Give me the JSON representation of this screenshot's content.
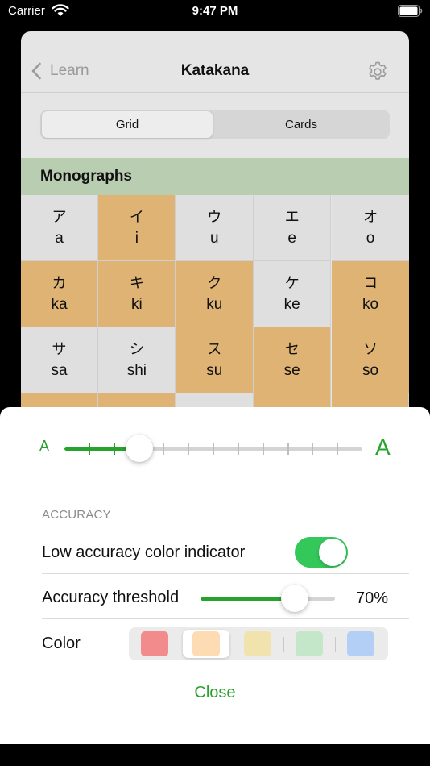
{
  "status_bar": {
    "carrier": "Carrier",
    "time": "9:47 PM"
  },
  "nav": {
    "back_label": "Learn",
    "title": "Katakana"
  },
  "segments": {
    "grid_label": "Grid",
    "cards_label": "Cards",
    "selected": "Grid"
  },
  "section": {
    "title": "Monographs"
  },
  "grid_rows": [
    [
      {
        "kana": "ア",
        "romaji": "a",
        "highlight": false
      },
      {
        "kana": "イ",
        "romaji": "i",
        "highlight": true
      },
      {
        "kana": "ウ",
        "romaji": "u",
        "highlight": false
      },
      {
        "kana": "エ",
        "romaji": "e",
        "highlight": false
      },
      {
        "kana": "オ",
        "romaji": "o",
        "highlight": false
      }
    ],
    [
      {
        "kana": "カ",
        "romaji": "ka",
        "highlight": true
      },
      {
        "kana": "キ",
        "romaji": "ki",
        "highlight": true
      },
      {
        "kana": "ク",
        "romaji": "ku",
        "highlight": true
      },
      {
        "kana": "ケ",
        "romaji": "ke",
        "highlight": false
      },
      {
        "kana": "コ",
        "romaji": "ko",
        "highlight": true
      }
    ],
    [
      {
        "kana": "サ",
        "romaji": "sa",
        "highlight": false
      },
      {
        "kana": "シ",
        "romaji": "shi",
        "highlight": false
      },
      {
        "kana": "ス",
        "romaji": "su",
        "highlight": true
      },
      {
        "kana": "セ",
        "romaji": "se",
        "highlight": true
      },
      {
        "kana": "ソ",
        "romaji": "so",
        "highlight": true
      }
    ]
  ],
  "font_size": {
    "small_label": "A",
    "large_label": "A",
    "steps": 13,
    "selected_step": 3
  },
  "accuracy": {
    "group_label": "ACCURACY",
    "indicator_label": "Low accuracy color indicator",
    "indicator_on": true,
    "threshold_label": "Accuracy threshold",
    "threshold_value": "70%",
    "threshold_fraction": 0.7,
    "color_label": "Color",
    "colors": [
      "#f28b8b",
      "#fddcb3",
      "#f1e3ad",
      "#c3e7c8",
      "#b3cff5"
    ],
    "selected_color_index": 1
  },
  "colors": {
    "accent": "#27a22c",
    "highlight_cell": "#dfb373",
    "plain_cell": "#dfdfdf",
    "header": "#b9ceb1"
  },
  "close_label": "Close"
}
